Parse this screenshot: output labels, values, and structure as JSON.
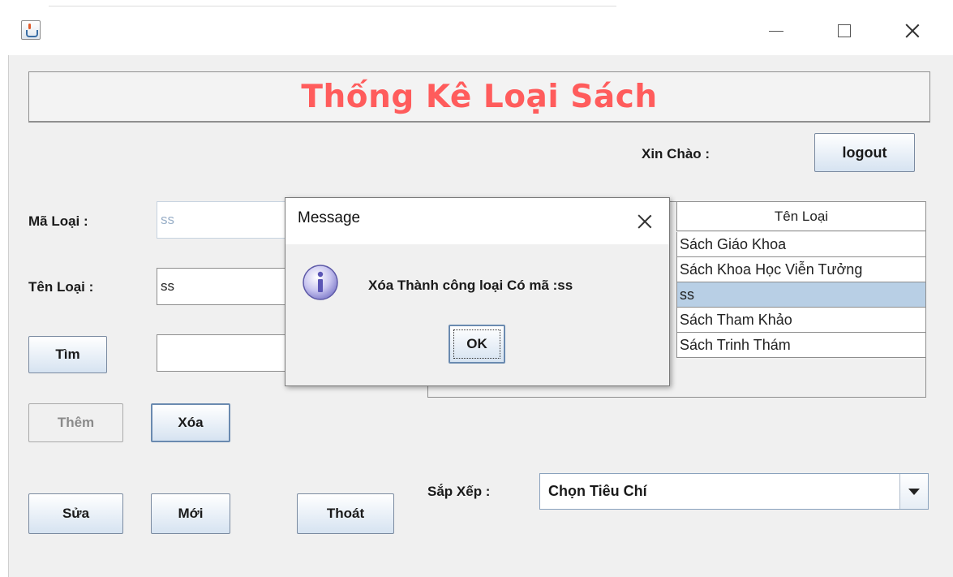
{
  "window": {
    "controls": {
      "minimize": "minimize-icon",
      "maximize": "maximize-icon",
      "close": "close-icon"
    }
  },
  "header": {
    "title": "Thống Kê Loại Sách"
  },
  "greeting": {
    "label": "Xin Chào :",
    "logout_label": "logout"
  },
  "form": {
    "ma_loai_label": "Mã Loại :",
    "ma_loai_value": "ss",
    "ten_loai_label": "Tên Loại :",
    "ten_loai_value": "ss",
    "search_value": ""
  },
  "buttons": {
    "tim": "Tìm",
    "them": "Thêm",
    "xoa": "Xóa",
    "sua": "Sửa",
    "moi": "Mới",
    "thoat": "Thoát"
  },
  "table": {
    "column": "Tên Loại",
    "rows": [
      "Sách Giáo Khoa",
      "Sách Khoa Học Viễn Tưởng",
      "ss",
      "Sách Tham Khảo",
      "Sách Trinh Thám"
    ],
    "selected_index": 2
  },
  "sort": {
    "label": "Sắp Xếp :",
    "selected": "Chọn Tiêu Chí"
  },
  "dialog": {
    "title": "Message",
    "message": "Xóa Thành công loại Có mã :ss",
    "ok_label": "OK",
    "icon": "info-icon"
  },
  "colors": {
    "title_red": "#ff5c5c",
    "selection": "#b8cfe5",
    "window_bg": "#f0f0f0"
  }
}
